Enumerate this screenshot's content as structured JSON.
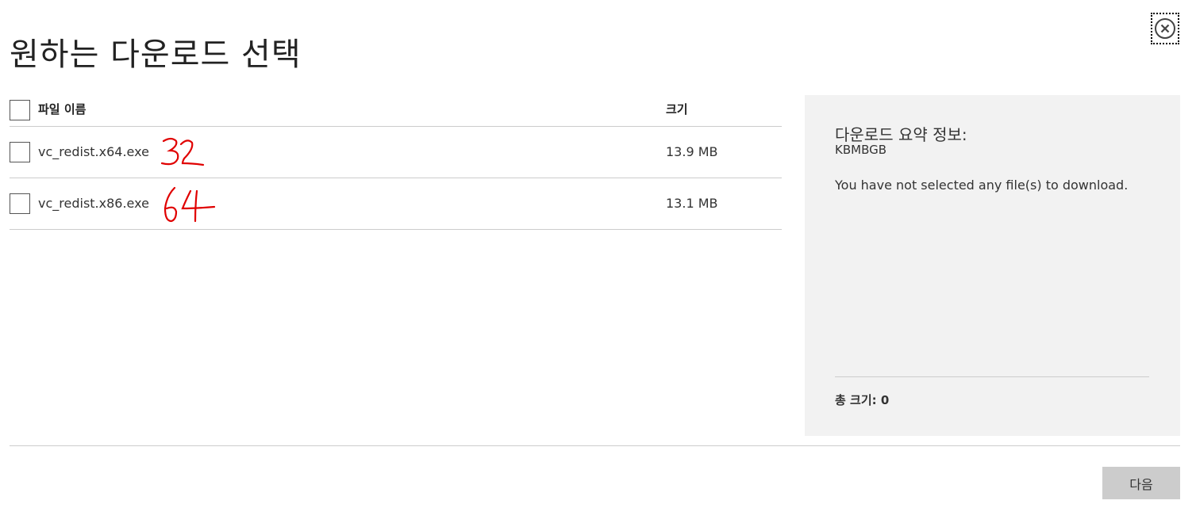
{
  "dialog": {
    "title": "원하는 다운로드 선택",
    "close_icon": "close-circle-icon"
  },
  "table": {
    "header": {
      "name_label": "파일 이름",
      "size_label": "크기",
      "select_all_checked": false
    },
    "rows": [
      {
        "name": "vc_redist.x64.exe",
        "size": "13.9 MB",
        "checked": false,
        "annotation": "32"
      },
      {
        "name": "vc_redist.x86.exe",
        "size": "13.1 MB",
        "checked": false,
        "annotation": "64"
      }
    ]
  },
  "summary": {
    "title": "다운로드 요약 정보:",
    "kb": "KBMBGB",
    "message": "You have not selected any file(s) to download.",
    "total_label": "총 크기: 0"
  },
  "footer": {
    "next_label": "다음"
  },
  "colors": {
    "annotation": "#e00000",
    "panel_bg": "#f2f2f2",
    "button_bg": "#cccccc"
  }
}
